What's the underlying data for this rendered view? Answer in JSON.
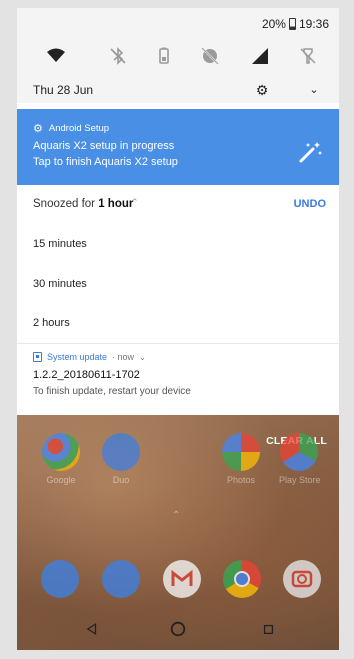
{
  "status_bar": {
    "battery": "20%",
    "time": "19:36"
  },
  "quick_settings": {
    "tiles": [
      {
        "icon": "wifi-icon"
      },
      {
        "icon": "bluetooth-off-icon"
      },
      {
        "icon": "battery-saver-icon"
      },
      {
        "icon": "do-not-disturb-off-icon"
      },
      {
        "icon": "mobile-signal-icon"
      },
      {
        "icon": "flashlight-off-icon"
      }
    ],
    "date": "Thu 28 Jun",
    "settings_icon": "gear-icon",
    "expand_icon": "chevron-down-icon"
  },
  "setup_notification": {
    "app_name": "Android Setup",
    "line1": "Aquaris X2 setup in progress",
    "line2": "Tap to finish Aquaris X2 setup",
    "color": "#4a8fe6"
  },
  "snooze": {
    "prefix": "Snoozed for ",
    "value": "1 hour",
    "undo_label": "UNDO",
    "options": [
      "15 minutes",
      "30 minutes",
      "2 hours"
    ]
  },
  "update_notification": {
    "app_name": "System update",
    "meta": "· now",
    "version": "1.2.2_20180611-1702",
    "message": "To finish update, restart your device"
  },
  "home": {
    "clear_all_label": "CLEAR ALL",
    "apps": [
      {
        "label": "Google"
      },
      {
        "label": "Duo"
      },
      {
        "label": "Photos"
      },
      {
        "label": "Play Store"
      }
    ],
    "dock": [
      {
        "icon": "phone-app-icon"
      },
      {
        "icon": "messages-app-icon"
      },
      {
        "icon": "gmail-app-icon"
      },
      {
        "icon": "chrome-app-icon"
      },
      {
        "icon": "camera-app-icon"
      }
    ]
  },
  "nav": {
    "back_icon": "back-icon",
    "home_icon": "home-icon",
    "recents_icon": "recents-icon"
  }
}
